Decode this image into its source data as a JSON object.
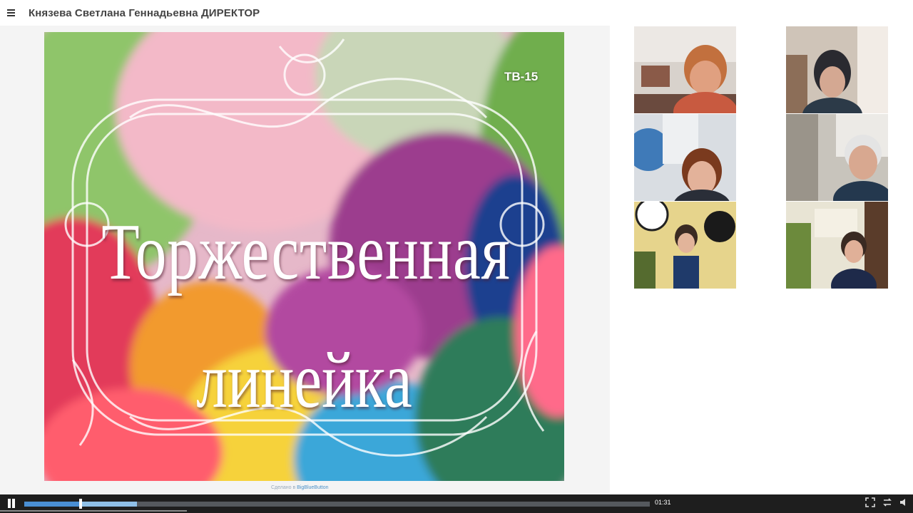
{
  "header": {
    "presenter_name": "Князева Светлана Геннадьевна ДИРЕКТОР"
  },
  "slide": {
    "title_line1": "Торжественная",
    "title_line2": "линейка",
    "badge": "ТВ-15",
    "credit_prefix": "Сделано в",
    "credit_app": "BigBlueButton"
  },
  "participants": [
    {
      "id": "p1",
      "icon": "participant-video-icon"
    },
    {
      "id": "p2",
      "icon": "participant-video-icon"
    },
    {
      "id": "p3",
      "icon": "participant-video-icon"
    },
    {
      "id": "p4",
      "icon": "participant-video-icon"
    },
    {
      "id": "p5",
      "icon": "participant-video-icon"
    },
    {
      "id": "p6",
      "icon": "participant-video-icon"
    }
  ],
  "player": {
    "time": "01:31",
    "played_fraction": 0.09,
    "buffered_fraction": 0.18,
    "controls": [
      "pause-icon",
      "fullscreen-icon",
      "swap-layout-icon",
      "volume-icon"
    ]
  },
  "colors": {
    "player_bg": "#1e1e1e",
    "progress_played": "#4a8fd4",
    "progress_buffered": "#8fc0e8",
    "header_text": "#444444"
  }
}
